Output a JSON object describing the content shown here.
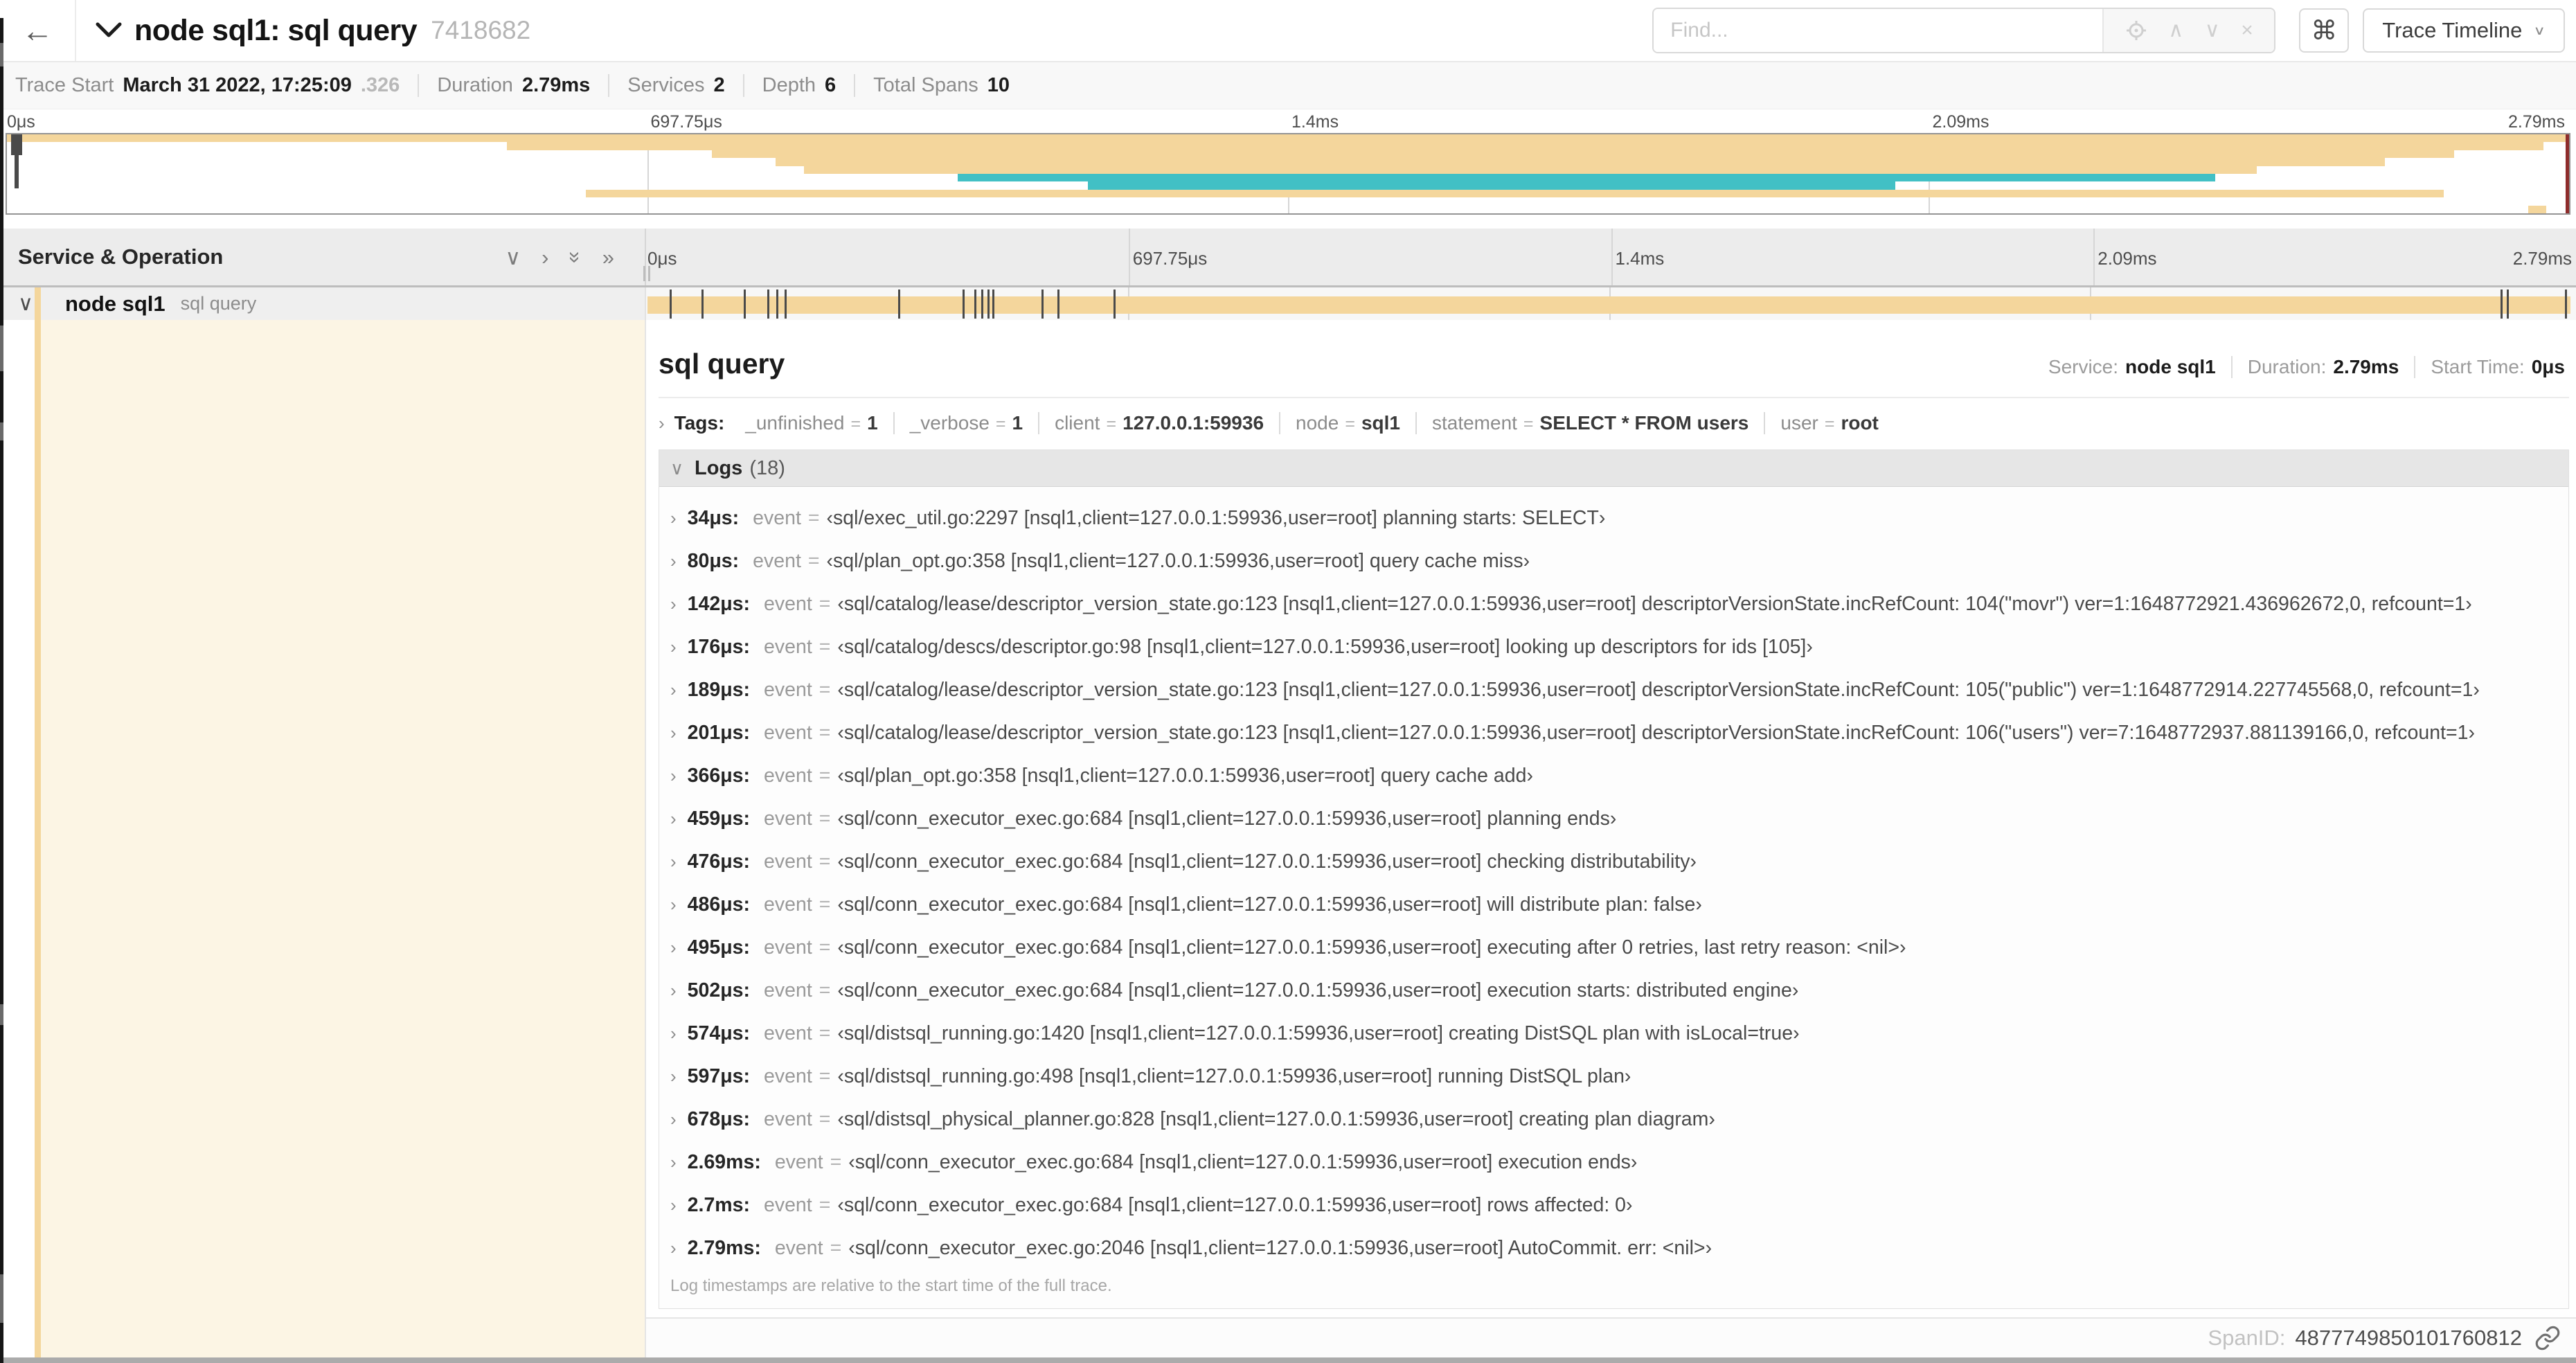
{
  "header": {
    "back_label": "←",
    "title": "node sql1: sql query",
    "trace_id_short": "7418682",
    "find_placeholder": "Find...",
    "shortcut_key": "⌘",
    "view_selector": "Trace Timeline"
  },
  "summary": {
    "items": [
      {
        "label": "Trace Start",
        "value": "March 31 2022, 17:25:09",
        "suffix": ".326"
      },
      {
        "label": "Duration",
        "value": "2.79ms"
      },
      {
        "label": "Services",
        "value": "2"
      },
      {
        "label": "Depth",
        "value": "6"
      },
      {
        "label": "Total Spans",
        "value": "10"
      }
    ]
  },
  "colors": {
    "span_tan": "#f4d69c",
    "span_teal": "#42c0c5",
    "detail_tint": "#fcf5e4",
    "minimap_scrubber": "#8e2c2b"
  },
  "minimap": {
    "axis_labels": [
      "0μs",
      "697.75μs",
      "1.4ms",
      "2.09ms",
      "2.79ms"
    ],
    "rows": 10,
    "spans": [
      {
        "row": 0,
        "start": 0.0,
        "end": 1.0,
        "color": "tan"
      },
      {
        "row": 1,
        "start": 0.195,
        "end": 0.99,
        "color": "tan"
      },
      {
        "row": 2,
        "start": 0.275,
        "end": 0.955,
        "color": "tan"
      },
      {
        "row": 3,
        "start": 0.3,
        "end": 0.928,
        "color": "tan"
      },
      {
        "row": 4,
        "start": 0.311,
        "end": 0.878,
        "color": "tan"
      },
      {
        "row": 5,
        "start": 0.371,
        "end": 0.862,
        "color": "teal"
      },
      {
        "row": 6,
        "start": 0.422,
        "end": 0.737,
        "color": "teal"
      },
      {
        "row": 7,
        "start": 0.226,
        "end": 0.951,
        "color": "tan"
      },
      {
        "row": 9,
        "start": 0.984,
        "end": 0.991,
        "color": "tan"
      }
    ]
  },
  "timeline": {
    "left_header": "Service & Operation",
    "ruler_ticks": [
      "0μs",
      "697.75μs",
      "1.4ms",
      "2.09ms",
      "2.79ms"
    ],
    "row": {
      "service": "node sql1",
      "operation": "sql query",
      "bar": {
        "start": 0,
        "end": 1,
        "color": "tan"
      },
      "log_markers": [
        0.0122,
        0.0287,
        0.0509,
        0.0631,
        0.0677,
        0.072,
        0.1312,
        0.1645,
        0.1706,
        0.1742,
        0.1774,
        0.1799,
        0.2057,
        0.214,
        0.243,
        0.9642,
        0.9677,
        0.998
      ]
    }
  },
  "detail": {
    "title": "sql query",
    "meta": [
      {
        "label": "Service:",
        "value": "node sql1"
      },
      {
        "label": "Duration:",
        "value": "2.79ms"
      },
      {
        "label": "Start Time:",
        "value": "0μs"
      }
    ],
    "tags_label": "Tags:",
    "tags": [
      {
        "key": "_unfinished",
        "value": "1"
      },
      {
        "key": "_verbose",
        "value": "1"
      },
      {
        "key": "client",
        "value": "127.0.0.1:59936"
      },
      {
        "key": "node",
        "value": "sql1"
      },
      {
        "key": "statement",
        "value": "SELECT * FROM users"
      },
      {
        "key": "user",
        "value": "root"
      }
    ],
    "logs_label": "Logs",
    "logs_count": "(18)",
    "logs": [
      {
        "ts": "34μs:",
        "key": "event",
        "value": "‹sql/exec_util.go:2297 [nsql1,client=127.0.0.1:59936,user=root] planning starts: SELECT›"
      },
      {
        "ts": "80μs:",
        "key": "event",
        "value": "‹sql/plan_opt.go:358 [nsql1,client=127.0.0.1:59936,user=root] query cache miss›"
      },
      {
        "ts": "142μs:",
        "key": "event",
        "value": "‹sql/catalog/lease/descriptor_version_state.go:123 [nsql1,client=127.0.0.1:59936,user=root] descriptorVersionState.incRefCount: 104(\"movr\") ver=1:1648772921.436962672,0, refcount=1›"
      },
      {
        "ts": "176μs:",
        "key": "event",
        "value": "‹sql/catalog/descs/descriptor.go:98 [nsql1,client=127.0.0.1:59936,user=root] looking up descriptors for ids [105]›"
      },
      {
        "ts": "189μs:",
        "key": "event",
        "value": "‹sql/catalog/lease/descriptor_version_state.go:123 [nsql1,client=127.0.0.1:59936,user=root] descriptorVersionState.incRefCount: 105(\"public\") ver=1:1648772914.227745568,0, refcount=1›"
      },
      {
        "ts": "201μs:",
        "key": "event",
        "value": "‹sql/catalog/lease/descriptor_version_state.go:123 [nsql1,client=127.0.0.1:59936,user=root] descriptorVersionState.incRefCount: 106(\"users\") ver=7:1648772937.881139166,0, refcount=1›"
      },
      {
        "ts": "366μs:",
        "key": "event",
        "value": "‹sql/plan_opt.go:358 [nsql1,client=127.0.0.1:59936,user=root] query cache add›"
      },
      {
        "ts": "459μs:",
        "key": "event",
        "value": "‹sql/conn_executor_exec.go:684 [nsql1,client=127.0.0.1:59936,user=root] planning ends›"
      },
      {
        "ts": "476μs:",
        "key": "event",
        "value": "‹sql/conn_executor_exec.go:684 [nsql1,client=127.0.0.1:59936,user=root] checking distributability›"
      },
      {
        "ts": "486μs:",
        "key": "event",
        "value": "‹sql/conn_executor_exec.go:684 [nsql1,client=127.0.0.1:59936,user=root] will distribute plan: false›"
      },
      {
        "ts": "495μs:",
        "key": "event",
        "value": "‹sql/conn_executor_exec.go:684 [nsql1,client=127.0.0.1:59936,user=root] executing after 0 retries, last retry reason: <nil>›"
      },
      {
        "ts": "502μs:",
        "key": "event",
        "value": "‹sql/conn_executor_exec.go:684 [nsql1,client=127.0.0.1:59936,user=root] execution starts: distributed engine›"
      },
      {
        "ts": "574μs:",
        "key": "event",
        "value": "‹sql/distsql_running.go:1420 [nsql1,client=127.0.0.1:59936,user=root] creating DistSQL plan with isLocal=true›"
      },
      {
        "ts": "597μs:",
        "key": "event",
        "value": "‹sql/distsql_running.go:498 [nsql1,client=127.0.0.1:59936,user=root] running DistSQL plan›"
      },
      {
        "ts": "678μs:",
        "key": "event",
        "value": "‹sql/distsql_physical_planner.go:828 [nsql1,client=127.0.0.1:59936,user=root] creating plan diagram›"
      },
      {
        "ts": "2.69ms:",
        "key": "event",
        "value": "‹sql/conn_executor_exec.go:684 [nsql1,client=127.0.0.1:59936,user=root] execution ends›"
      },
      {
        "ts": "2.7ms:",
        "key": "event",
        "value": "‹sql/conn_executor_exec.go:684 [nsql1,client=127.0.0.1:59936,user=root] rows affected: 0›"
      },
      {
        "ts": "2.79ms:",
        "key": "event",
        "value": "‹sql/conn_executor_exec.go:2046 [nsql1,client=127.0.0.1:59936,user=root] AutoCommit. err: <nil>›"
      }
    ],
    "logs_footer": "Log timestamps are relative to the start time of the full trace.",
    "span_id_label": "SpanID:",
    "span_id": "4877749850101760812"
  }
}
